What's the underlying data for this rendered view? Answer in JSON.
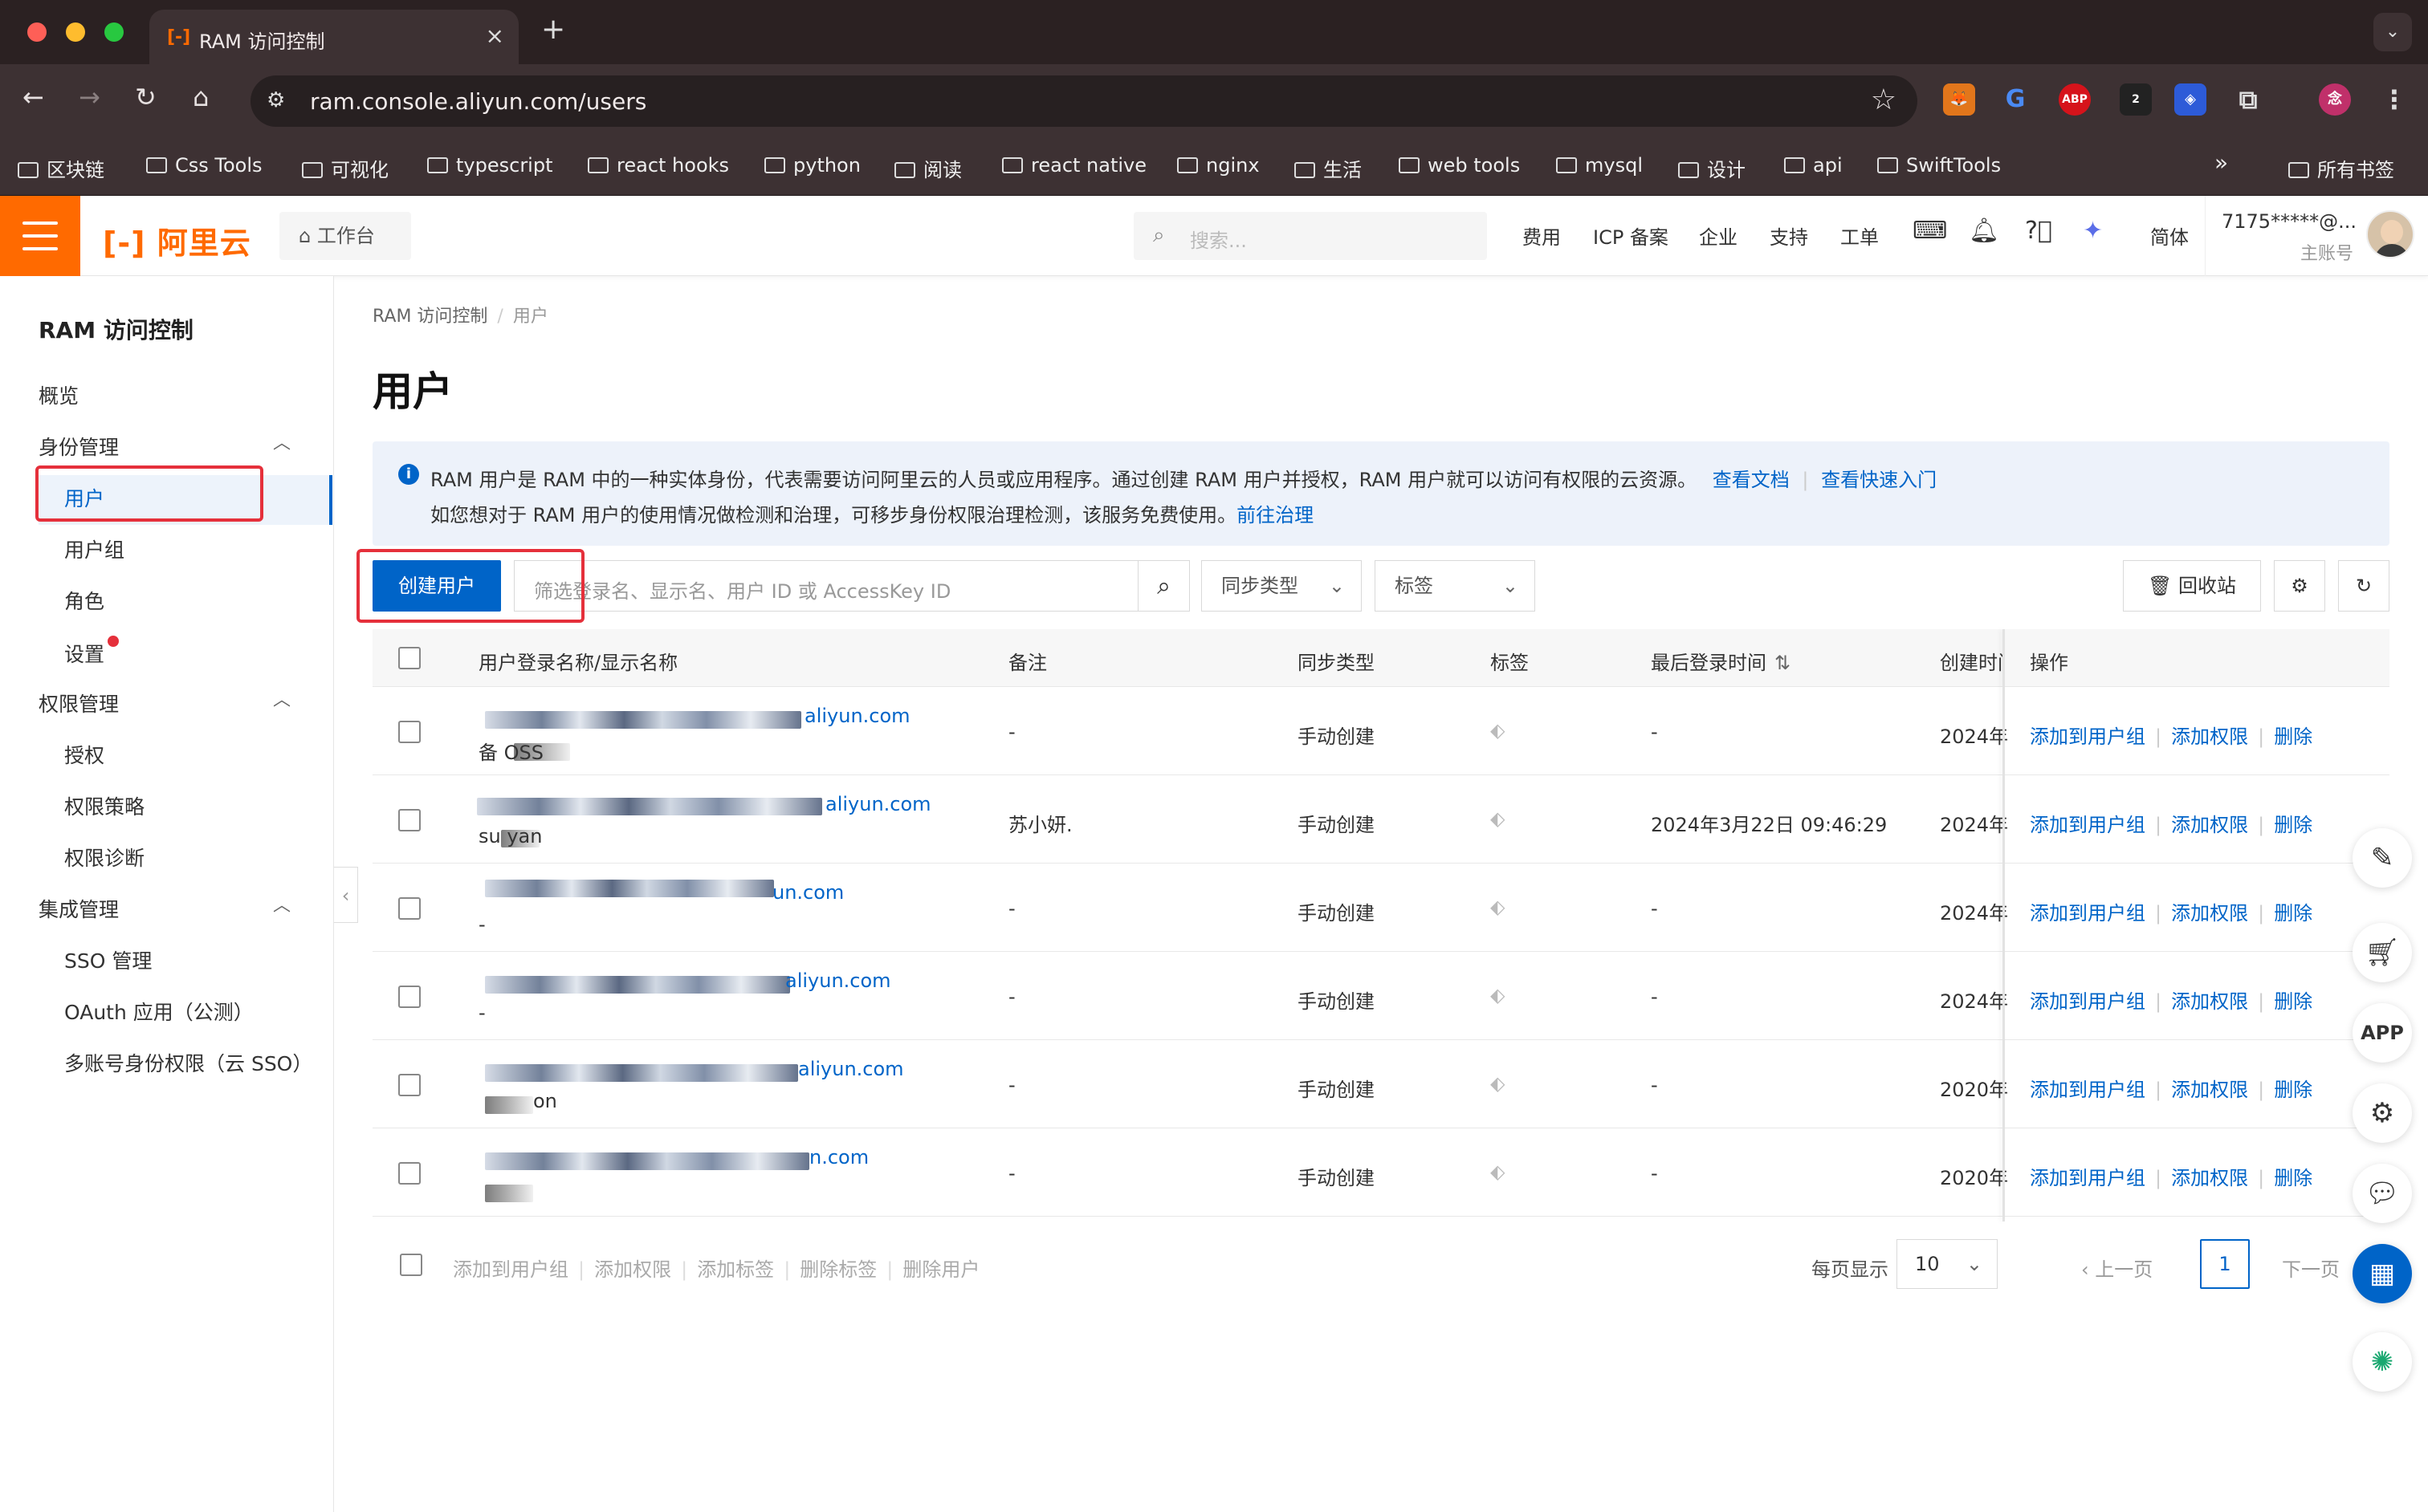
{
  "browser": {
    "tab_title": "RAM 访问控制",
    "url": "ram.console.aliyun.com/users",
    "bookmarks": [
      "区块链",
      "Css Tools",
      "可视化",
      "typescript",
      "react hooks",
      "python",
      "阅读",
      "react native",
      "nginx",
      "生活",
      "web tools",
      "mysql",
      "设计",
      "api",
      "SwiftTools"
    ],
    "all_bookmarks": "所有书签",
    "extensions": [
      "fox-icon",
      "g-icon",
      "ABP",
      "2",
      "cube-icon",
      "puzzle-icon",
      "profile-icon"
    ]
  },
  "header": {
    "logo": "阿里云",
    "workbench": "工作台",
    "search_placeholder": "搜索...",
    "nav": [
      "费用",
      "ICP 备案",
      "企业",
      "支持",
      "工单"
    ],
    "lang": "简体",
    "account_name": "7175*****@...",
    "account_role": "主账号"
  },
  "sidebar": {
    "title": "RAM 访问控制",
    "overview": "概览",
    "groups": [
      {
        "label": "身份管理",
        "items": [
          "用户",
          "用户组",
          "角色",
          "设置"
        ]
      },
      {
        "label": "权限管理",
        "items": [
          "授权",
          "权限策略",
          "权限诊断"
        ]
      },
      {
        "label": "集成管理",
        "items": [
          "SSO 管理",
          "OAuth 应用（公测）",
          "多账号身份权限（云 SSO）"
        ]
      }
    ]
  },
  "main": {
    "breadcrumb": [
      "RAM 访问控制",
      "用户"
    ],
    "title": "用户",
    "notice_line1": "RAM 用户是 RAM 中的一种实体身份，代表需要访问阿里云的人员或应用程序。通过创建 RAM 用户并授权，RAM 用户就可以访问有权限的云资源。",
    "notice_link1": "查看文档",
    "notice_link2": "查看快速入门",
    "notice_line2": "如您想对于 RAM 用户的使用情况做检测和治理，可移步身份权限治理检测，该服务免费使用。",
    "notice_link3": "前往治理",
    "create_button": "创建用户",
    "filter_placeholder": "筛选登录名、显示名、用户 ID 或 AccessKey ID",
    "sync_select": "同步类型",
    "tag_select": "标签",
    "recycle_button": "回收站"
  },
  "table": {
    "headers": [
      "用户登录名称/显示名称",
      "备注",
      "同步类型",
      "标签",
      "最后登录时间",
      "创建时间",
      "操作"
    ],
    "rows": [
      {
        "login_suffix": "aliyun.com",
        "display": "备 OSS",
        "note": "-",
        "sync": "手动创建",
        "last_login": "-",
        "created": "2024年"
      },
      {
        "login_suffix": "aliyun.com",
        "display": "su yan",
        "note": "苏小妍.",
        "sync": "手动创建",
        "last_login": "2024年3月22日 09:46:29",
        "created": "2024年"
      },
      {
        "login_suffix": "un.com",
        "display": "-",
        "note": "-",
        "sync": "手动创建",
        "last_login": "-",
        "created": "2024年"
      },
      {
        "login_suffix": "aliyun.com",
        "display": "-",
        "note": "-",
        "sync": "手动创建",
        "last_login": "-",
        "created": "2024年"
      },
      {
        "login_suffix": "aliyun.com",
        "display": "on",
        "note": "-",
        "sync": "手动创建",
        "last_login": "-",
        "created": "2020年"
      },
      {
        "login_suffix": "n.com",
        "display": "",
        "note": "-",
        "sync": "手动创建",
        "last_login": "-",
        "created": "2020年"
      }
    ],
    "row_actions": [
      "添加到用户组",
      "添加权限",
      "删除"
    ]
  },
  "footer": {
    "bulk_actions": [
      "添加到用户组",
      "添加权限",
      "添加标签",
      "删除标签",
      "删除用户"
    ],
    "page_size_label": "每页显示",
    "page_size": "10",
    "prev": "上一页",
    "current_page": "1",
    "next": "下一页"
  },
  "colors": {
    "brand_orange": "#ff6a00",
    "primary_blue": "#0064c8",
    "highlight_red": "#e5303b"
  }
}
